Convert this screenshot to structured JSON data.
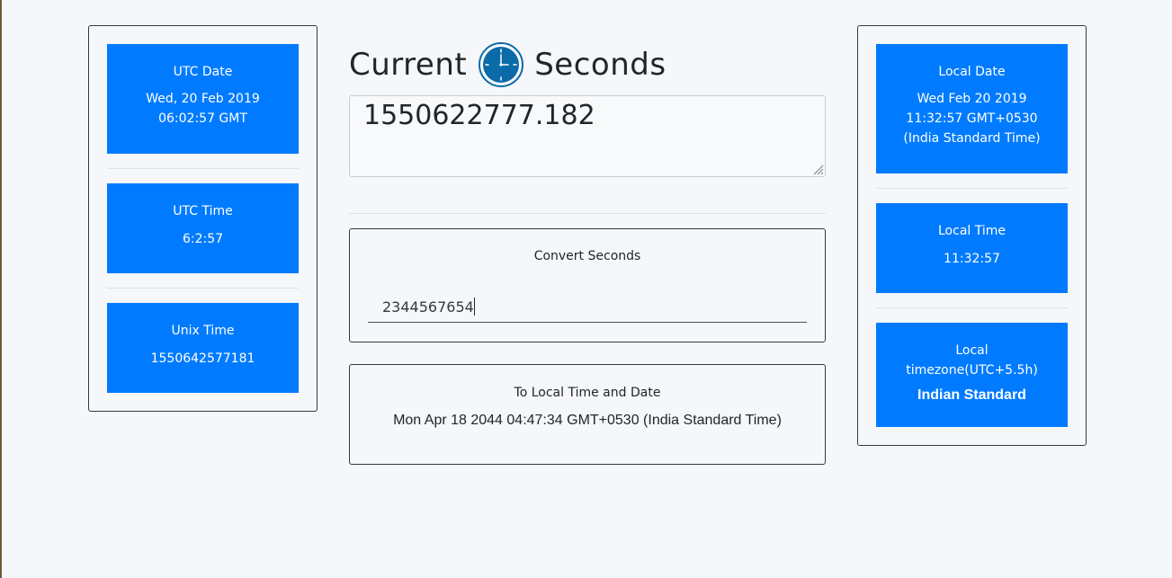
{
  "colors": {
    "accent": "#007bff",
    "background": "#f5f7fa",
    "border": "#343a40",
    "clock_ring": "#0b6aa8"
  },
  "header": {
    "title_left": "Current",
    "icon": "clock-icon",
    "title_right": "Seconds"
  },
  "current_seconds": "1550622777.182",
  "left_panel": {
    "utc_date": {
      "label": "UTC Date",
      "line1": "Wed, 20 Feb 2019",
      "line2": "06:02:57 GMT"
    },
    "utc_time": {
      "label": "UTC Time",
      "value": "6:2:57"
    },
    "unix_time": {
      "label": "Unix Time",
      "value": "1550642577181"
    }
  },
  "convert": {
    "label": "Convert Seconds",
    "input_value": "2344567654"
  },
  "result": {
    "label": "To Local Time and Date",
    "value": "Mon Apr 18 2044 04:47:34 GMT+0530 (India Standard Time)"
  },
  "right_panel": {
    "local_date": {
      "label": "Local Date",
      "line1": "Wed Feb 20 2019",
      "line2": "11:32:57 GMT+0530",
      "line3": "(India Standard Time)"
    },
    "local_time": {
      "label": "Local Time",
      "value": "11:32:57"
    },
    "local_timezone": {
      "label": "Local timezone(UTC+5.5h)",
      "value": "Indian Standard"
    }
  }
}
